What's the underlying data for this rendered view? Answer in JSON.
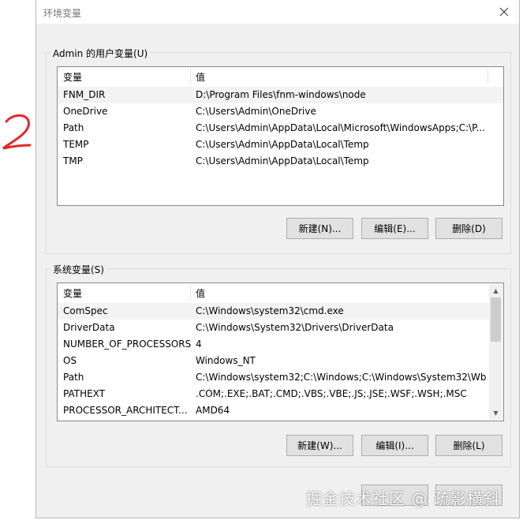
{
  "window": {
    "title": "环境变量"
  },
  "user_group": {
    "label": "Admin 的用户变量(U)",
    "columns": [
      "变量",
      "值"
    ],
    "rows": [
      {
        "name": "FNM_DIR",
        "value": "D:\\Program Files\\fnm-windows\\node"
      },
      {
        "name": "OneDrive",
        "value": "C:\\Users\\Admin\\OneDrive"
      },
      {
        "name": "Path",
        "value": "C:\\Users\\Admin\\AppData\\Local\\Microsoft\\WindowsApps;C:\\P..."
      },
      {
        "name": "TEMP",
        "value": "C:\\Users\\Admin\\AppData\\Local\\Temp"
      },
      {
        "name": "TMP",
        "value": "C:\\Users\\Admin\\AppData\\Local\\Temp"
      }
    ],
    "buttons": {
      "new": "新建(N)...",
      "edit": "编辑(E)...",
      "delete": "删除(D)"
    }
  },
  "system_group": {
    "label": "系统变量(S)",
    "columns": [
      "变量",
      "值"
    ],
    "rows": [
      {
        "name": "ComSpec",
        "value": "C:\\Windows\\system32\\cmd.exe"
      },
      {
        "name": "DriverData",
        "value": "C:\\Windows\\System32\\Drivers\\DriverData"
      },
      {
        "name": "NUMBER_OF_PROCESSORS",
        "value": "4"
      },
      {
        "name": "OS",
        "value": "Windows_NT"
      },
      {
        "name": "Path",
        "value": "C:\\Windows\\system32;C:\\Windows;C:\\Windows\\System32\\Wb..."
      },
      {
        "name": "PATHEXT",
        "value": ".COM;.EXE;.BAT;.CMD;.VBS;.VBE;.JS;.JSE;.WSF;.WSH;.MSC"
      },
      {
        "name": "PROCESSOR_ARCHITECT...",
        "value": "AMD64"
      }
    ],
    "buttons": {
      "new": "新建(W)...",
      "edit": "编辑(I)...",
      "delete": "删除(L)"
    }
  },
  "annotation": {
    "number": "2",
    "color": "#e5262b"
  },
  "watermark": "掘金技术社区 @ 疏影横斜"
}
